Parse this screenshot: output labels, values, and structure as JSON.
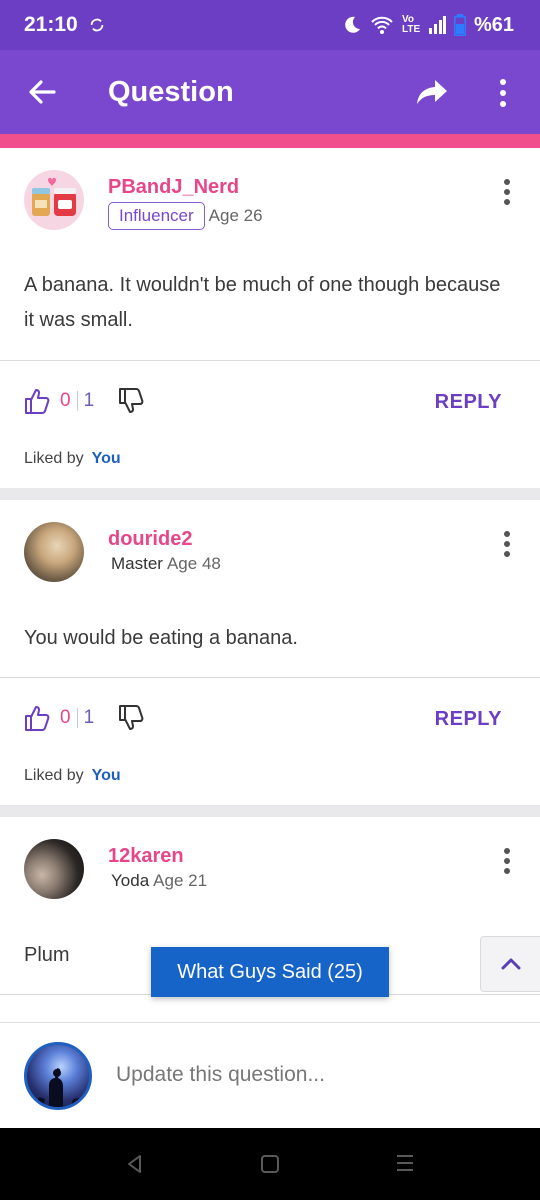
{
  "status_bar": {
    "time": "21:10",
    "battery": "%61",
    "network": "Vo LTE"
  },
  "app_bar": {
    "title": "Question"
  },
  "answers": [
    {
      "username": "PBandJ_Nerd",
      "badge": "Influencer",
      "age": "Age 26",
      "text": "A banana. It wouldn't be much of one though because it was small.",
      "likes": "0",
      "dislikes": "1",
      "reply": "REPLY",
      "liked_by_label": "Liked by",
      "liked_by": "You"
    },
    {
      "username": "douride2",
      "rank": "Master",
      "age": "Age 48",
      "text": "You would be eating a banana.",
      "likes": "0",
      "dislikes": "1",
      "reply": "REPLY",
      "liked_by_label": "Liked by",
      "liked_by": "You"
    },
    {
      "username": "12karen",
      "rank": "Yoda",
      "age": "Age 21",
      "text": "Plum"
    }
  ],
  "floating": {
    "filter_label": "What Guys Said (25)"
  },
  "composer": {
    "placeholder": "Update this question..."
  },
  "colors": {
    "status_bar": "#6b3ec3",
    "app_bar": "#7a47cf",
    "accent": "#f0508c",
    "username": "#e8468a",
    "link_blue": "#1e5fc0",
    "fab": "#1664c8"
  }
}
